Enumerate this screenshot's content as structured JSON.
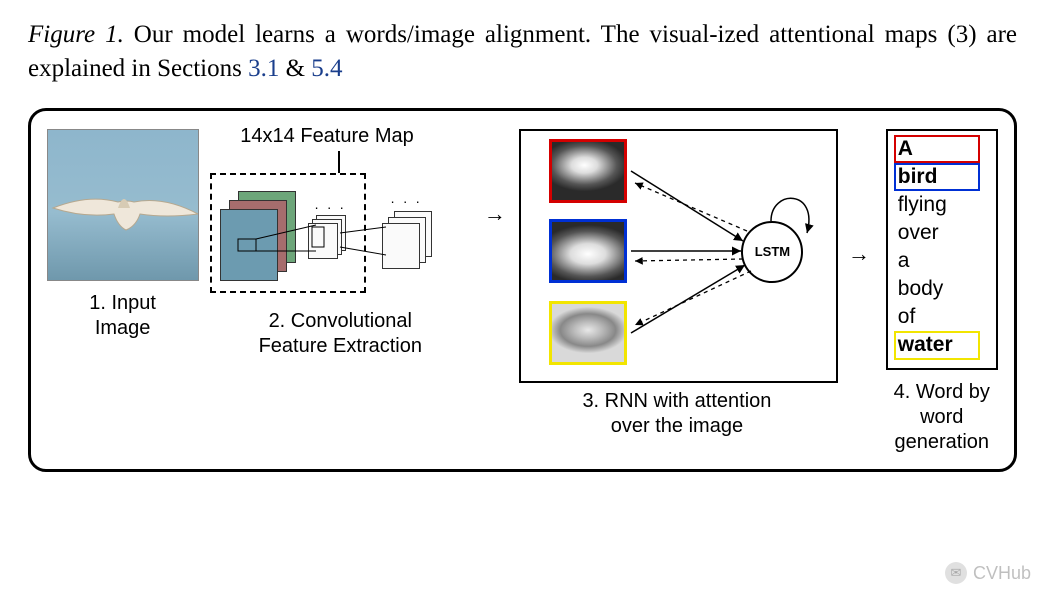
{
  "caption": {
    "fig_label": "Figure 1.",
    "text_1": " Our model learns a words/image alignment. The visual-ized attentional maps (3) are explained in Sections ",
    "ref_a": "3.1",
    "amp": " & ",
    "ref_b": "5.4"
  },
  "diagram": {
    "feature_map_label": "14x14 Feature Map",
    "lstm_label": "LSTM",
    "arrow_12": "→",
    "arrow_34": "→",
    "panels": {
      "p1": {
        "label_line1": "1. Input",
        "label_line2": "Image"
      },
      "p2": {
        "label_line1": "2. Convolutional",
        "label_line2": "Feature Extraction"
      },
      "p3": {
        "label_line1": "3. RNN with attention",
        "label_line2": "over the image"
      },
      "p4": {
        "label_line1": "4. Word by",
        "label_line2": "word",
        "label_line3": "generation"
      }
    },
    "words": [
      {
        "text": "A",
        "border": "red",
        "bold": true
      },
      {
        "text": "bird",
        "border": "blue",
        "bold": true
      },
      {
        "text": "flying",
        "border": "none",
        "bold": false
      },
      {
        "text": "over",
        "border": "none",
        "bold": false
      },
      {
        "text": "a",
        "border": "none",
        "bold": false
      },
      {
        "text": "body",
        "border": "none",
        "bold": false
      },
      {
        "text": "of",
        "border": "none",
        "bold": false
      },
      {
        "text": "water",
        "border": "yellow",
        "bold": true
      }
    ],
    "attention_tiles": [
      {
        "border_color": "#d40000"
      },
      {
        "border_color": "#0030d4"
      },
      {
        "border_color": "#f2e500"
      }
    ]
  },
  "watermark": {
    "text": "CVHub",
    "icon_alt": "wechat-icon"
  }
}
